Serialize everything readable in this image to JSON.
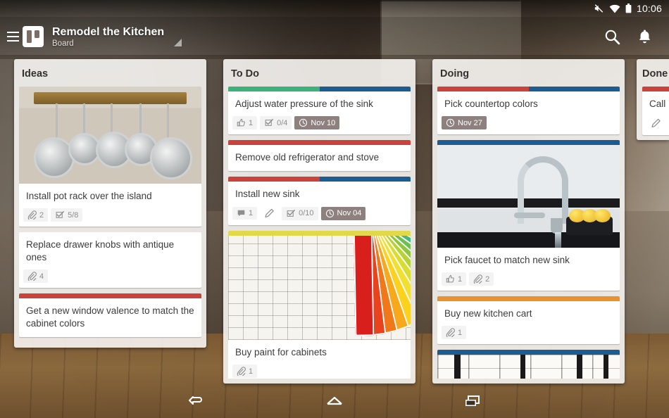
{
  "status_bar": {
    "icons": [
      "mute-icon",
      "wifi-icon",
      "battery-icon"
    ],
    "time": "10:06"
  },
  "toolbar": {
    "menu_icon": "hamburger-icon",
    "logo_icon": "trello-logo-icon",
    "title": "Remodel the Kitchen",
    "subtitle": "Board",
    "dropdown_icon": "board-caret-icon",
    "search_icon": "search-icon",
    "notifications_icon": "bell-icon"
  },
  "label_colors": {
    "green": "#3cb179",
    "blue": "#1c5c93",
    "red": "#c9433c",
    "orange": "#e8912d",
    "yellow": "#e2d94a",
    "purple": "#b06fd0"
  },
  "lists": [
    {
      "title": "Ideas",
      "cards": [
        {
          "title": "Install pot rack over the island",
          "cover": "pot-rack-photo",
          "labels": [],
          "badges": [
            {
              "icon": "attachment-icon",
              "text": "2"
            },
            {
              "icon": "checklist-icon",
              "text": "5/8"
            }
          ]
        },
        {
          "title": "Replace drawer knobs with antique ones",
          "cover": null,
          "labels": [],
          "badges": [
            {
              "icon": "attachment-icon",
              "text": "4"
            }
          ]
        },
        {
          "title": "Get a new window valence to match the cabinet colors",
          "cover": null,
          "labels": [
            "red"
          ],
          "badges": []
        }
      ]
    },
    {
      "title": "To Do",
      "cards": [
        {
          "title": "Adjust water pressure of the sink",
          "cover": null,
          "labels": [
            "green",
            "blue"
          ],
          "badges": [
            {
              "icon": "thumbs-up-icon",
              "text": "1"
            },
            {
              "icon": "checklist-icon",
              "text": "0/4"
            },
            {
              "icon": "clock-icon",
              "text": "Nov 10",
              "due": true
            }
          ]
        },
        {
          "title": "Remove old refrigerator and stove",
          "cover": null,
          "labels": [
            "red"
          ],
          "badges": []
        },
        {
          "title": "Install new sink",
          "cover": null,
          "labels": [
            "red",
            "blue"
          ],
          "badges": [
            {
              "icon": "comment-icon",
              "text": "1"
            },
            {
              "icon": "description-icon",
              "text": ""
            },
            {
              "icon": "checklist-icon",
              "text": "0/10"
            },
            {
              "icon": "clock-icon",
              "text": "Nov 04",
              "due": true
            }
          ]
        },
        {
          "title": "Buy paint for cabinets",
          "cover": "paint-swatch-fan-photo",
          "labels": [
            "yellow"
          ],
          "badges": [
            {
              "icon": "attachment-icon",
              "text": "1"
            }
          ]
        },
        {
          "title": "",
          "cover": null,
          "labels": [
            "yellow",
            "purple"
          ],
          "badges": []
        }
      ]
    },
    {
      "title": "Doing",
      "cards": [
        {
          "title": "Pick countertop colors",
          "cover": null,
          "labels": [
            "red",
            "blue"
          ],
          "badges": [
            {
              "icon": "clock-icon",
              "text": "Nov 27",
              "due": true
            }
          ]
        },
        {
          "title": "Pick faucet to match new sink",
          "cover": "kitchen-faucet-photo",
          "labels": [
            "blue"
          ],
          "badges": [
            {
              "icon": "thumbs-up-icon",
              "text": "1"
            },
            {
              "icon": "attachment-icon",
              "text": "2"
            }
          ]
        },
        {
          "title": "Buy new kitchen cart",
          "cover": null,
          "labels": [
            "orange"
          ],
          "badges": [
            {
              "icon": "attachment-icon",
              "text": "1"
            }
          ]
        },
        {
          "title": "",
          "cover": "floor-plan-blueprint-photo",
          "labels": [
            "blue"
          ],
          "badges": []
        }
      ]
    }
  ],
  "done_list": {
    "title": "Done",
    "card": {
      "title": "Call",
      "labels": [
        "red"
      ],
      "badges": [
        {
          "icon": "description-icon",
          "text": ""
        }
      ]
    }
  },
  "nav_bar": {
    "back_icon": "back-icon",
    "home_icon": "home-icon",
    "recents_icon": "recents-icon"
  }
}
